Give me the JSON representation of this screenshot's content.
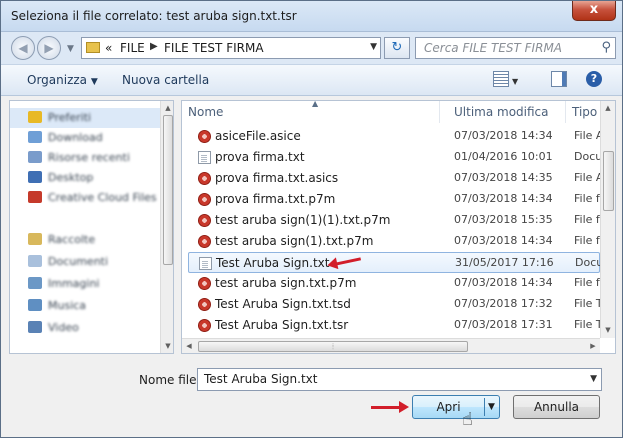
{
  "window": {
    "title": "Seleziona il file correlato: test aruba sign.txt.tsr",
    "close_glyph": "x"
  },
  "address": {
    "prefix": "«",
    "crumbs": [
      "FILE",
      "FILE TEST FIRMA"
    ],
    "search_placeholder": "Cerca FILE TEST FIRMA"
  },
  "toolbar": {
    "organize_label": "Organizza",
    "new_folder_label": "Nuova cartella"
  },
  "sidebar": {
    "items": [
      {
        "label": "Preferiti",
        "icon": "star-icon",
        "color": "#e8b925"
      },
      {
        "label": "Download",
        "icon": "download-folder-icon",
        "color": "#6f9fd6"
      },
      {
        "label": "Risorse recenti",
        "icon": "recent-icon",
        "color": "#7a9ccb"
      },
      {
        "label": "Desktop",
        "icon": "desktop-icon",
        "color": "#3f6fb4"
      },
      {
        "label": "Creative Cloud Files",
        "icon": "cloud-folder-icon",
        "color": "#c53a2b"
      },
      {
        "label": "Raccolte",
        "icon": "library-icon",
        "color": "#d8b85c"
      },
      {
        "label": "Documenti",
        "icon": "documents-icon",
        "color": "#a9c0dc"
      },
      {
        "label": "Immagini",
        "icon": "pictures-icon",
        "color": "#6c98c6"
      },
      {
        "label": "Musica",
        "icon": "music-icon",
        "color": "#5f8fc2"
      },
      {
        "label": "Video",
        "icon": "video-icon",
        "color": "#5a82b5"
      }
    ]
  },
  "columns": {
    "name": "Nome",
    "modified": "Ultima modifica",
    "type": "Tipo"
  },
  "files": [
    {
      "name": "asiceFile.asice",
      "date": "07/03/2018 14:34",
      "type": "File A",
      "icon": "seal"
    },
    {
      "name": "prova firma.txt",
      "date": "01/04/2016 10:01",
      "type": "Docu",
      "icon": "doc"
    },
    {
      "name": "prova firma.txt.asics",
      "date": "07/03/2018 14:35",
      "type": "File A",
      "icon": "seal"
    },
    {
      "name": "prova firma.txt.p7m",
      "date": "07/03/2018 14:34",
      "type": "File f",
      "icon": "seal"
    },
    {
      "name": "test aruba sign(1)(1).txt.p7m",
      "date": "07/03/2018 15:35",
      "type": "File f",
      "icon": "seal"
    },
    {
      "name": "test aruba sign(1).txt.p7m",
      "date": "07/03/2018 14:34",
      "type": "File f",
      "icon": "seal"
    },
    {
      "name": "Test Aruba Sign.txt",
      "date": "31/05/2017 17:16",
      "type": "Docu",
      "icon": "doc",
      "selected": true
    },
    {
      "name": "test aruba sign.txt.p7m",
      "date": "07/03/2018 14:34",
      "type": "File f",
      "icon": "seal"
    },
    {
      "name": "Test Aruba Sign.txt.tsd",
      "date": "07/03/2018 17:32",
      "type": "File T",
      "icon": "seal"
    },
    {
      "name": "Test Aruba Sign.txt.tsr",
      "date": "07/03/2018 17:31",
      "type": "File T",
      "icon": "seal"
    }
  ],
  "footer": {
    "filename_label": "Nome file:",
    "filename_value": "Test Aruba Sign.txt",
    "open_label": "Apri",
    "cancel_label": "Annulla"
  },
  "colors": {
    "annotation_arrow": "#d21e2a",
    "accent": "#3c7fb1"
  }
}
